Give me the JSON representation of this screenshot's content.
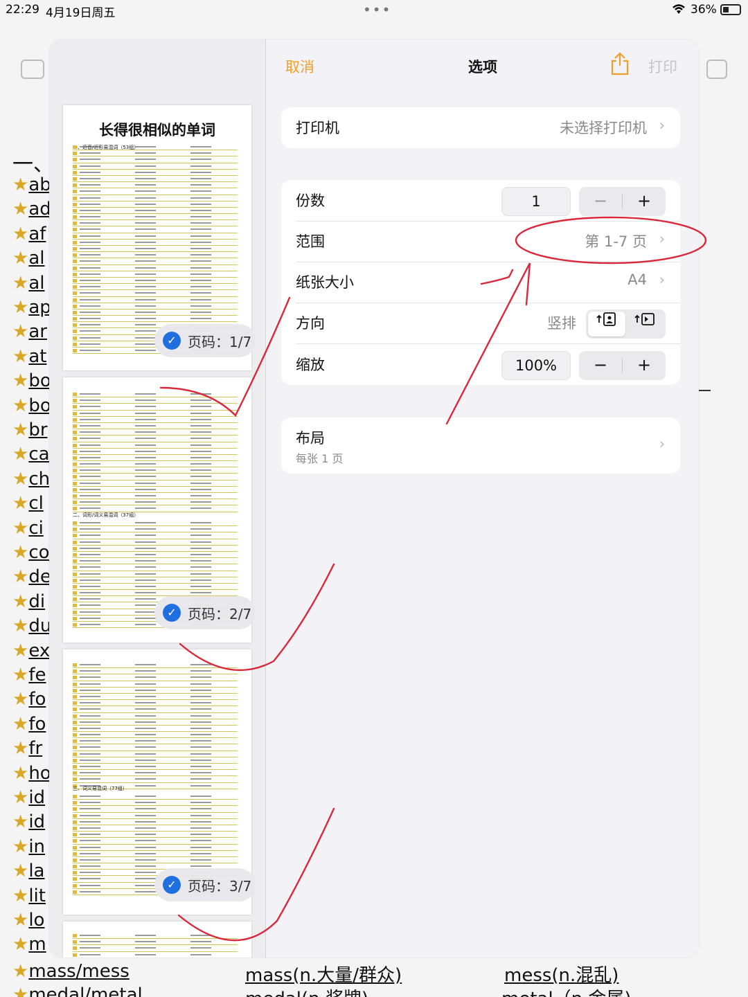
{
  "status_bar": {
    "time": "22:29",
    "date": "4月19日周五",
    "dots": "•••",
    "battery": "36%"
  },
  "background": {
    "heading": "一、",
    "rows": [
      "ab",
      "ad",
      "af",
      "al",
      "al",
      "ap",
      "ar",
      "at",
      "bo",
      "bo",
      "br",
      "ca",
      "ch",
      "cl",
      "ci",
      "co",
      "de",
      "di",
      "du",
      "ex",
      "fe",
      "fo",
      "fo",
      "fr",
      "ho",
      "id",
      "id",
      "in",
      "la",
      "lit",
      "lo",
      "m"
    ],
    "bottom_rows": [
      {
        "word": "mass/mess",
        "mid": "mass(n.大量/群众)",
        "right": "mess(n.混乱)"
      },
      {
        "word": "medal/metal",
        "mid": "medal(n.奖牌)",
        "right": "metal（n.金属)"
      }
    ]
  },
  "preview": {
    "page1_title": "长得很相似的单词",
    "page1_subtitle": "一、近音/近形易混词（53组）",
    "page2_subtitle": "二、词形/词义易混词（37组）",
    "page3_subtitle": "三、词义易混词（77组）",
    "badges": [
      "页码：1/7",
      "页码：2/7",
      "页码：3/7"
    ]
  },
  "nav": {
    "cancel": "取消",
    "title": "选项",
    "print": "打印"
  },
  "printer": {
    "label": "打印机",
    "value": "未选择打印机"
  },
  "copies": {
    "label": "份数",
    "value": "1"
  },
  "range": {
    "label": "范围",
    "value": "第 1-7 页"
  },
  "paper": {
    "label": "纸张大小",
    "value": "A4"
  },
  "orientation": {
    "label": "方向",
    "value": "竖排"
  },
  "scale": {
    "label": "缩放",
    "value": "100%"
  },
  "layout": {
    "label": "布局",
    "sub": "每张 1 页"
  },
  "stepper": {
    "minus": "−",
    "plus": "+"
  },
  "colors": {
    "accent": "#f0a028",
    "check": "#1f6fe0",
    "annotation": "#d8283a"
  }
}
